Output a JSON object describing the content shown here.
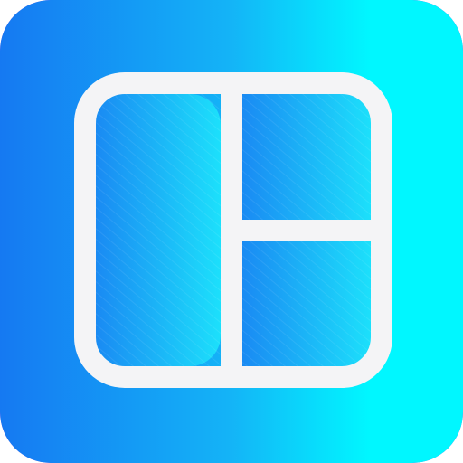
{
  "app_icon": {
    "icon": "collage-layout-icon",
    "colors": {
      "gradient_start": "#1579f2",
      "gradient_mid": "#14b4f7",
      "gradient_end": "#00f7ff",
      "rim": "#7a4de6",
      "frame": "#f4f4f6",
      "cell_fill_start": "#1a8af3",
      "cell_fill_end": "#1ce0fb"
    }
  }
}
